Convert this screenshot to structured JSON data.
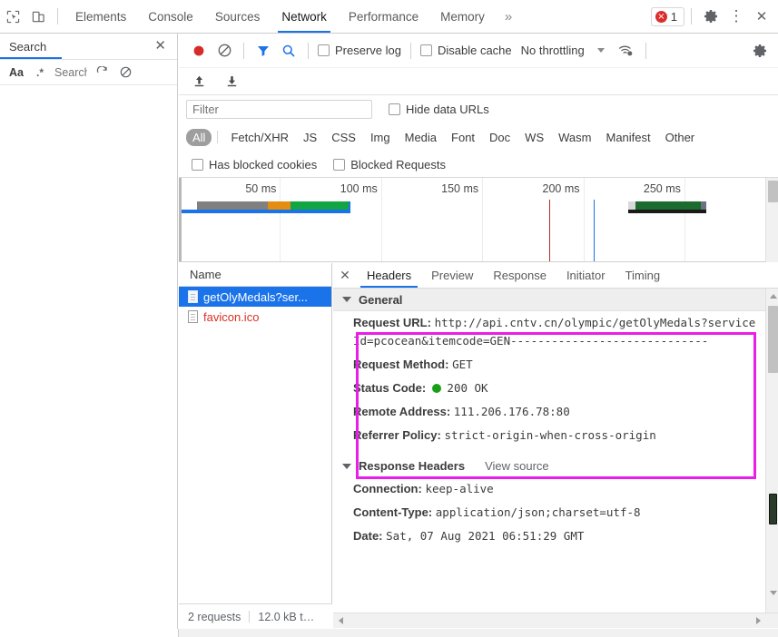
{
  "devtools": {
    "icons": {
      "inspect": "inspect-element-icon",
      "device": "device-toolbar-icon"
    },
    "tabs": [
      {
        "label": "Elements",
        "active": false
      },
      {
        "label": "Console",
        "active": false
      },
      {
        "label": "Sources",
        "active": false
      },
      {
        "label": "Network",
        "active": true
      },
      {
        "label": "Performance",
        "active": false
      },
      {
        "label": "Memory",
        "active": false
      }
    ],
    "more_tabs_label": "»",
    "error_badge": {
      "count": "1",
      "glyph": "×"
    },
    "settings_label": "⚙",
    "menu_label": "⋮",
    "close_label": "✕",
    "accent_color": "#1a73e8"
  },
  "search_drawer": {
    "tab_label": "Search",
    "close_label": "✕",
    "match_case_label": "Aa",
    "regex_label": ".*",
    "input_value": "Search",
    "refresh_label": "↻",
    "clear_label": "⊘"
  },
  "network_toolbar": {
    "record_label": "record-button",
    "clear_label": "clear-button",
    "filter_label": "filter-button",
    "search_label": "search-button",
    "preserve_log_label": "Preserve log",
    "disable_cache_label": "Disable cache",
    "throttling_value": "No throttling",
    "import_har_label": "import-har-button",
    "export_har_label": "export-har-button",
    "network_conditions_label": "network-conditions-icon",
    "settings_label": "⚙"
  },
  "filter_bar": {
    "filter_placeholder": "Filter",
    "filter_value": "",
    "hide_data_urls_label": "Hide data URLs",
    "types": [
      {
        "label": "All",
        "active": true
      },
      {
        "label": "Fetch/XHR",
        "active": false
      },
      {
        "label": "JS",
        "active": false
      },
      {
        "label": "CSS",
        "active": false
      },
      {
        "label": "Img",
        "active": false
      },
      {
        "label": "Media",
        "active": false
      },
      {
        "label": "Font",
        "active": false
      },
      {
        "label": "Doc",
        "active": false
      },
      {
        "label": "WS",
        "active": false
      },
      {
        "label": "Wasm",
        "active": false
      },
      {
        "label": "Manifest",
        "active": false
      },
      {
        "label": "Other",
        "active": false
      }
    ],
    "has_blocked_cookies_label": "Has blocked cookies",
    "blocked_requests_label": "Blocked Requests"
  },
  "chart_data": {
    "type": "timeline",
    "title": "Network overview waterfall",
    "xlabel": "ms",
    "xlim": [
      0,
      290
    ],
    "ticks": [
      {
        "label": "50 ms",
        "value": 50
      },
      {
        "label": "100 ms",
        "value": 100
      },
      {
        "label": "150 ms",
        "value": 150
      },
      {
        "label": "200 ms",
        "value": 200
      },
      {
        "label": "250 ms",
        "value": 250
      }
    ],
    "event_lines": [
      {
        "name": "DOMContentLoaded",
        "value": 183,
        "color": "#b52b2b"
      },
      {
        "name": "Load",
        "value": 205,
        "color": "#1a73e8"
      }
    ],
    "requests": [
      {
        "name": "getOlyMedals?serviceId=pcocean",
        "start": 1,
        "end": 85,
        "segments": [
          {
            "phase": "queueing",
            "start": 1,
            "end": 9,
            "color": "#ffffff"
          },
          {
            "phase": "stalled",
            "start": 9,
            "end": 44,
            "color": "#808080"
          },
          {
            "phase": "request-sent",
            "start": 44,
            "end": 55,
            "color": "#e58c13"
          },
          {
            "phase": "waiting",
            "start": 55,
            "end": 84,
            "color": "#12a544"
          },
          {
            "phase": "download",
            "start": 84,
            "end": 85,
            "color": "#1a73e8"
          }
        ],
        "underline_color": "#1a73e8"
      },
      {
        "name": "favicon.ico",
        "start": 222,
        "end": 261,
        "segments": [
          {
            "phase": "stalled",
            "start": 222,
            "end": 226,
            "color": "#d9d9d9"
          },
          {
            "phase": "waiting",
            "start": 226,
            "end": 258,
            "color": "#1c6b2f"
          },
          {
            "phase": "download",
            "start": 258,
            "end": 261,
            "color": "#6b7280"
          }
        ],
        "underline_color": "#1a1a1a"
      }
    ]
  },
  "request_list": {
    "column_header": "Name",
    "rows": [
      {
        "name": "getOlyMedals?ser...",
        "selected": true,
        "error": false
      },
      {
        "name": "favicon.ico",
        "selected": false,
        "error": true
      }
    ]
  },
  "detail": {
    "close_label": "✕",
    "tabs": [
      {
        "label": "Headers",
        "active": true
      },
      {
        "label": "Preview",
        "active": false
      },
      {
        "label": "Response",
        "active": false
      },
      {
        "label": "Initiator",
        "active": false
      },
      {
        "label": "Timing",
        "active": false
      }
    ],
    "general": {
      "section_title": "General",
      "request_url_key": "Request URL:",
      "request_url_value": "http://api.cntv.cn/olympic/getOlyMedals?serviceId=pcocean&itemcode=GEN-----------------------------",
      "request_method_key": "Request Method:",
      "request_method_value": "GET",
      "status_code_key": "Status Code:",
      "status_code_value": "200  OK",
      "status_color": "#18a018",
      "remote_address_key": "Remote Address:",
      "remote_address_value": "111.206.176.78:80",
      "referrer_policy_key": "Referrer Policy:",
      "referrer_policy_value": "strict-origin-when-cross-origin"
    },
    "response_headers": {
      "section_title": "Response Headers",
      "view_source_label": "View source",
      "items": [
        {
          "key": "Connection:",
          "value": "keep-alive"
        },
        {
          "key": "Content-Type:",
          "value": "application/json;charset=utf-8"
        },
        {
          "key": "Date:",
          "value": "Sat, 07 Aug 2021 06:51:29 GMT"
        }
      ]
    },
    "highlight_color": "#e91ee9"
  },
  "status_bar": {
    "requests_text": "2 requests",
    "transferred_text": "12.0 kB t…"
  }
}
